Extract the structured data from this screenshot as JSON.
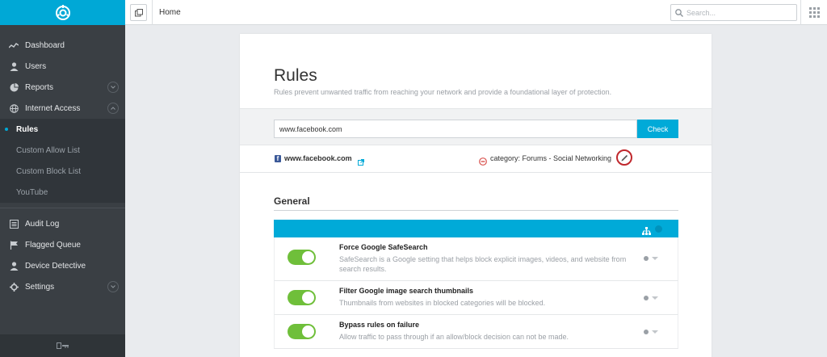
{
  "topbar": {
    "breadcrumb": "Home",
    "search_placeholder": "Search..."
  },
  "sidebar": {
    "items": [
      {
        "label": "Dashboard",
        "icon": "trend-icon"
      },
      {
        "label": "Users",
        "icon": "user-icon"
      },
      {
        "label": "Reports",
        "icon": "pie-chart-icon",
        "expandable": true
      },
      {
        "label": "Internet Access",
        "icon": "globe-icon",
        "expanded": true
      }
    ],
    "subitems": [
      "Rules",
      "Custom Allow List",
      "Custom Block List",
      "YouTube"
    ],
    "active_subitem": "Rules",
    "items2": [
      {
        "label": "Audit Log",
        "icon": "list-icon"
      },
      {
        "label": "Flagged Queue",
        "icon": "flag-icon"
      },
      {
        "label": "Device Detective",
        "icon": "user-icon"
      },
      {
        "label": "Settings",
        "icon": "gear-icon",
        "expandable": true
      }
    ]
  },
  "page": {
    "title": "Rules",
    "subtitle": "Rules prevent unwanted traffic from reaching your network and provide a foundational layer of protection."
  },
  "checker": {
    "input_value": "www.facebook.com",
    "button_label": "Check",
    "result_site": "www.facebook.com",
    "result_category": "category: Forums - Social Networking"
  },
  "general": {
    "title": "General",
    "rules": [
      {
        "title": "Force Google SafeSearch",
        "desc": "SafeSearch is a Google setting that helps block explicit images, videos, and website from search results.",
        "enabled": true
      },
      {
        "title": "Filter Google image search thumbnails",
        "desc": "Thumbnails from websites in blocked categories will be blocked.",
        "enabled": true
      },
      {
        "title": "Bypass rules on failure",
        "desc": "Allow traffic to pass through if an allow/block decision can not be made.",
        "enabled": true
      }
    ]
  },
  "colors": {
    "accent": "#00aad8",
    "sidebar": "#3a3f44",
    "toggle_on": "#6fbf3a",
    "highlight": "#c0282d"
  }
}
